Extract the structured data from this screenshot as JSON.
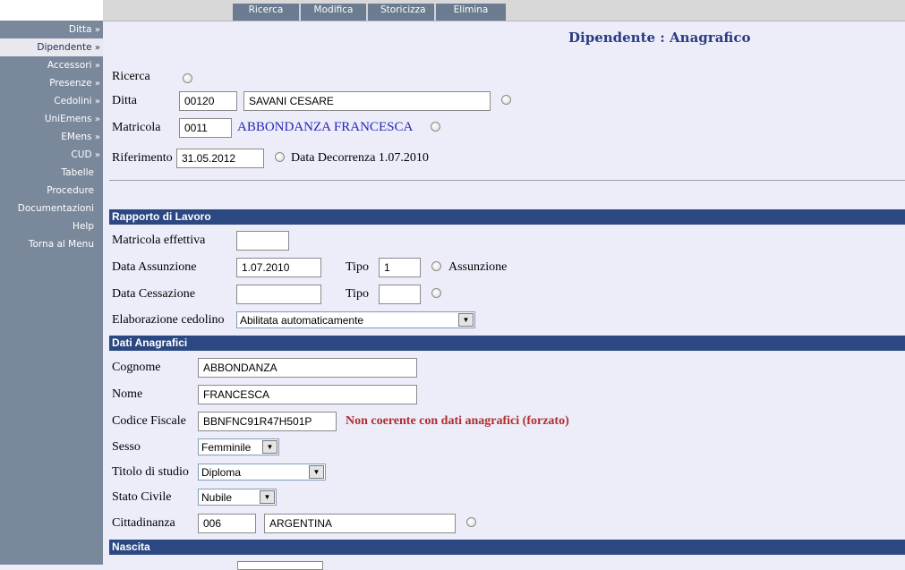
{
  "sidebar": {
    "items": [
      {
        "label": "Ditta",
        "chevron": "»"
      },
      {
        "label": "Dipendente",
        "chevron": "»"
      },
      {
        "label": "Accessori",
        "chevron": "»"
      },
      {
        "label": "Presenze",
        "chevron": "»"
      },
      {
        "label": "Cedolini",
        "chevron": "»"
      },
      {
        "label": "UniEmens",
        "chevron": "»"
      },
      {
        "label": "EMens",
        "chevron": "»"
      },
      {
        "label": "CUD",
        "chevron": "»"
      },
      {
        "label": "Tabelle",
        "chevron": ""
      },
      {
        "label": "Procedure",
        "chevron": ""
      },
      {
        "label": "Documentazioni",
        "chevron": ""
      },
      {
        "label": "Help",
        "chevron": ""
      },
      {
        "label": "Torna al Menu",
        "chevron": ""
      }
    ]
  },
  "tabs": [
    "Ricerca",
    "Modifica",
    "Storicizza",
    "Elimina"
  ],
  "page": {
    "title": "Dipendente : Anagrafico"
  },
  "header_form": {
    "ricerca_label": "Ricerca",
    "ditta_label": "Ditta",
    "ditta_code": "00120",
    "ditta_name": "SAVANI CESARE",
    "matricola_label": "Matricola",
    "matricola_code": "0011",
    "matricola_name": "ABBONDANZA FRANCESCA",
    "riferimento_label": "Riferimento",
    "riferimento_date": "31.05.2012",
    "decorrenza_text": "Data Decorrenza 1.07.2010"
  },
  "rapporto": {
    "section_title": "Rapporto di Lavoro",
    "matricola_effettiva_label": "Matricola effettiva",
    "matricola_effettiva_value": "",
    "data_assunzione_label": "Data Assunzione",
    "data_assunzione_value": "1.07.2010",
    "tipo_label": "Tipo",
    "tipo_assunzione_value": "1",
    "assunzione_label": "Assunzione",
    "data_cessazione_label": "Data Cessazione",
    "data_cessazione_value": "",
    "tipo_cessazione_value": "",
    "elaborazione_label": "Elaborazione cedolino",
    "elaborazione_value": "Abilitata automaticamente"
  },
  "anagrafici": {
    "section_title": "Dati Anagrafici",
    "cognome_label": "Cognome",
    "cognome_value": "ABBONDANZA",
    "nome_label": "Nome",
    "nome_value": "FRANCESCA",
    "cf_label": "Codice Fiscale",
    "cf_value": "BBNFNC91R47H501P",
    "cf_warning": "Non coerente con dati anagrafici (forzato)",
    "sesso_label": "Sesso",
    "sesso_value": "Femminile",
    "titolo_label": "Titolo di studio",
    "titolo_value": "Diploma",
    "stato_label": "Stato Civile",
    "stato_value": "Nubile",
    "cittadinanza_label": "Cittadinanza",
    "cittadinanza_code": "006",
    "cittadinanza_name": "ARGENTINA"
  },
  "nascita": {
    "section_title": "Nascita"
  },
  "colors": {
    "sidebar_bg": "#7a889c",
    "tab_bg": "#6b7b90",
    "section_bar": "#2c4882",
    "page_bg": "#ededfa",
    "title_color": "#2b3c80",
    "warning_color": "#b02d2d",
    "link_blue": "#2626b8"
  }
}
